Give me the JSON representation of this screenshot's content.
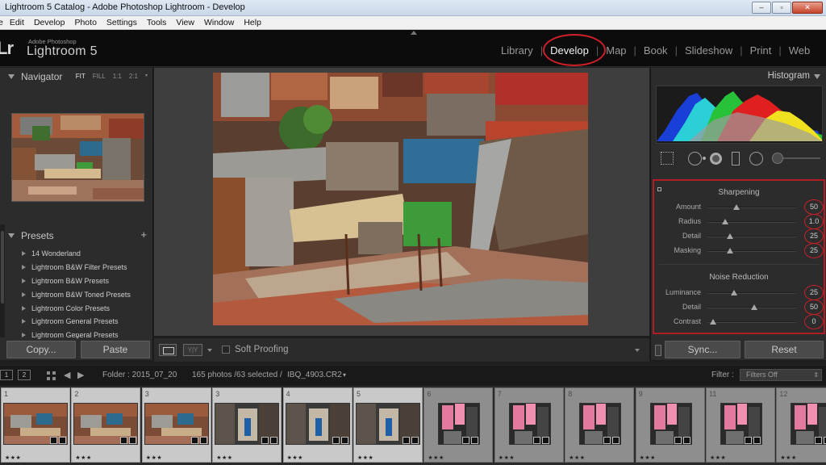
{
  "window": {
    "title": "Lightroom 5 Catalog - Adobe Photoshop Lightroom - Develop",
    "min": "–",
    "restore": "▫",
    "close": "✕"
  },
  "menu": [
    "Edit",
    "Develop",
    "Photo",
    "Settings",
    "Tools",
    "View",
    "Window",
    "Help"
  ],
  "identity": {
    "logo": "Lr",
    "brand_sub": "Adobe Photoshop",
    "brand_main": "Lightroom 5"
  },
  "modules": [
    "Library",
    "Develop",
    "Map",
    "Book",
    "Slideshow",
    "Print",
    "Web"
  ],
  "active_module": "Develop",
  "navigator": {
    "title": "Navigator",
    "zoom": [
      "FIT",
      "FILL",
      "1:1",
      "2:1"
    ],
    "zoom_active": "FIT"
  },
  "presets": {
    "title": "Presets",
    "add": "+",
    "items": [
      "14 Wonderland",
      "Lightroom B&W Filter Presets",
      "Lightroom B&W Presets",
      "Lightroom B&W Toned Presets",
      "Lightroom Color Presets",
      "Lightroom General Presets",
      "Lightroom General Presets"
    ]
  },
  "left_buttons": {
    "copy": "Copy...",
    "paste": "Paste"
  },
  "toolbar": {
    "before_after": "Y|Y",
    "soft_proofing": "Soft Proofing"
  },
  "histogram": {
    "title": "Histogram"
  },
  "detail": {
    "sharpening_title": "Sharpening",
    "sharpening": [
      {
        "label": "Amount",
        "value": "50",
        "pos": 0.33
      },
      {
        "label": "Radius",
        "value": "1.0",
        "pos": 0.2
      },
      {
        "label": "Detail",
        "value": "25",
        "pos": 0.25
      },
      {
        "label": "Masking",
        "value": "25",
        "pos": 0.25
      }
    ],
    "noise_title": "Noise Reduction",
    "noise": [
      {
        "label": "Luminance",
        "value": "25",
        "pos": 0.3
      },
      {
        "label": "Detail",
        "value": "50",
        "pos": 0.53
      },
      {
        "label": "Contrast",
        "value": "0",
        "pos": 0.06
      }
    ]
  },
  "right_buttons": {
    "sync": "Sync...",
    "reset": "Reset"
  },
  "filmstrip_header": {
    "page1": "1",
    "page2": "2",
    "folder": "Folder : 2015_07_20",
    "count": "165 photos /63 selected /",
    "selected_file": "IBQ_4903.CR2",
    "dropdown": "▾",
    "filter_label": "Filter :",
    "filter_value": "Filters Off"
  },
  "filmstrip": [
    {
      "num": "1",
      "stars": "★★★",
      "selected": true,
      "kind": "roofs"
    },
    {
      "num": "2",
      "stars": "★★★",
      "selected": true,
      "kind": "roofs"
    },
    {
      "num": "3",
      "stars": "★★★",
      "selected": true,
      "kind": "roofs"
    },
    {
      "num": "3",
      "stars": "★★★",
      "selected": true,
      "kind": "alley"
    },
    {
      "num": "4",
      "stars": "★★★",
      "selected": true,
      "kind": "alley"
    },
    {
      "num": "5",
      "stars": "★★★",
      "selected": true,
      "kind": "alley"
    },
    {
      "num": "6",
      "stars": "★★★",
      "selected": false,
      "kind": "pink"
    },
    {
      "num": "7",
      "stars": "★★★",
      "selected": false,
      "kind": "pink"
    },
    {
      "num": "8",
      "stars": "★★★",
      "selected": false,
      "kind": "pink"
    },
    {
      "num": "9",
      "stars": "★★★",
      "selected": false,
      "kind": "pink"
    },
    {
      "num": "11",
      "stars": "★★★",
      "selected": false,
      "kind": "pink"
    },
    {
      "num": "12",
      "stars": "★★★",
      "selected": false,
      "kind": "pink"
    }
  ],
  "colors": {
    "annotation_red": "#d0202a",
    "panel": "#2c2c2c",
    "workspace": "#3e3e3e"
  }
}
